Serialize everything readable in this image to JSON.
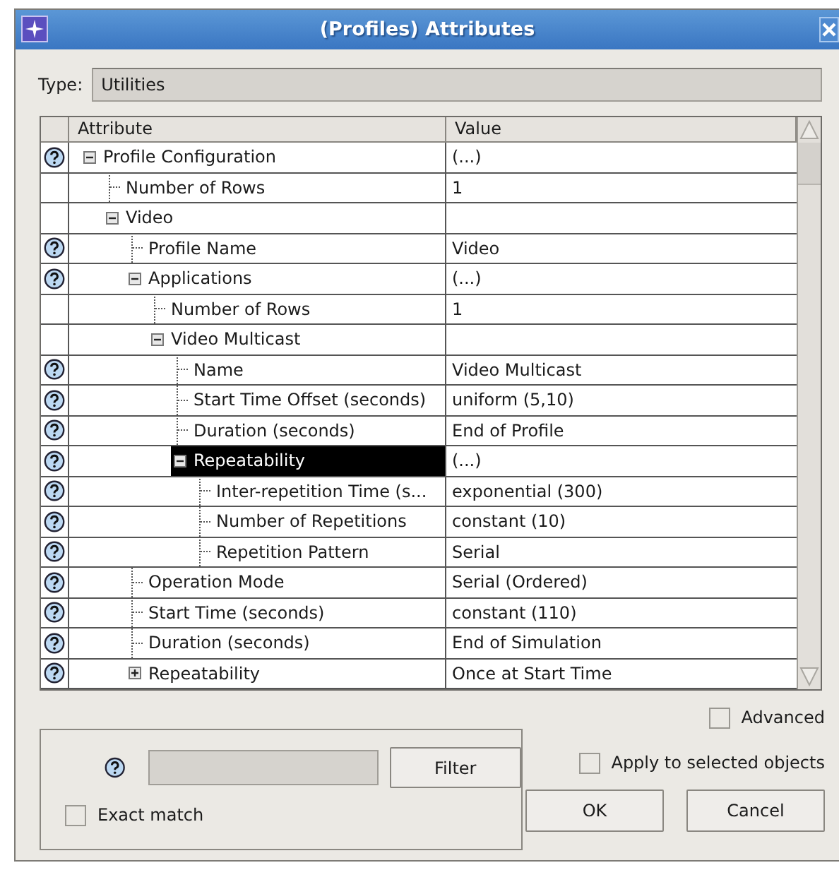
{
  "window": {
    "title": "(Profiles) Attributes"
  },
  "type_field": {
    "label": "Type:",
    "value": "Utilities"
  },
  "table": {
    "columns": [
      "Attribute",
      "Value"
    ],
    "rows": [
      {
        "attribute": "Profile Configuration",
        "value": "(...)",
        "help": true,
        "expanded": true,
        "selected": false,
        "children": [
          {
            "attribute": "Number of Rows",
            "value": "1",
            "help": false,
            "selected": false
          },
          {
            "attribute": "Video",
            "help": false,
            "expanded": true,
            "selected": false,
            "children": [
              {
                "attribute": "Profile Name",
                "value": "Video",
                "help": true,
                "selected": false
              },
              {
                "attribute": "Applications",
                "value": "(...)",
                "help": true,
                "expanded": true,
                "selected": false,
                "children": [
                  {
                    "attribute": "Number of Rows",
                    "value": "1",
                    "help": false,
                    "selected": false
                  },
                  {
                    "attribute": "Video Multicast",
                    "help": false,
                    "expanded": true,
                    "selected": false,
                    "children": [
                      {
                        "attribute": "Name",
                        "value": "Video Multicast",
                        "help": true,
                        "selected": false
                      },
                      {
                        "attribute": "Start Time Offset (seconds)",
                        "value": "uniform (5,10)",
                        "help": true,
                        "selected": false
                      },
                      {
                        "attribute": "Duration (seconds)",
                        "value": "End of Profile",
                        "help": true,
                        "selected": false
                      },
                      {
                        "attribute": "Repeatability",
                        "value": "(...)",
                        "help": true,
                        "expanded": true,
                        "selected": true,
                        "children": [
                          {
                            "attribute": "Inter-repetition Time (s...",
                            "value": "exponential (300)",
                            "help": true,
                            "selected": false
                          },
                          {
                            "attribute": "Number of Repetitions",
                            "value": "constant (10)",
                            "help": true,
                            "selected": false
                          },
                          {
                            "attribute": "Repetition Pattern",
                            "value": "Serial",
                            "help": true,
                            "selected": false
                          }
                        ]
                      }
                    ]
                  }
                ]
              },
              {
                "attribute": "Operation Mode",
                "value": "Serial (Ordered)",
                "help": true,
                "selected": false
              },
              {
                "attribute": "Start Time (seconds)",
                "value": "constant (110)",
                "help": true,
                "selected": false
              },
              {
                "attribute": "Duration (seconds)",
                "value": "End of Simulation",
                "help": true,
                "selected": false
              },
              {
                "attribute": "Repeatability",
                "value": "Once at Start Time",
                "help": true,
                "expanded": false,
                "selected": false
              }
            ]
          }
        ]
      }
    ]
  },
  "filter": {
    "button": {
      "label": "Filter"
    },
    "exact_match": {
      "label": "Exact match",
      "checked": false
    }
  },
  "advanced": {
    "label": "Advanced",
    "checked": false
  },
  "apply_to_selected": {
    "label": "Apply to selected objects",
    "checked": false
  },
  "buttons": [
    {
      "label": "OK"
    },
    {
      "label": "Cancel"
    }
  ]
}
